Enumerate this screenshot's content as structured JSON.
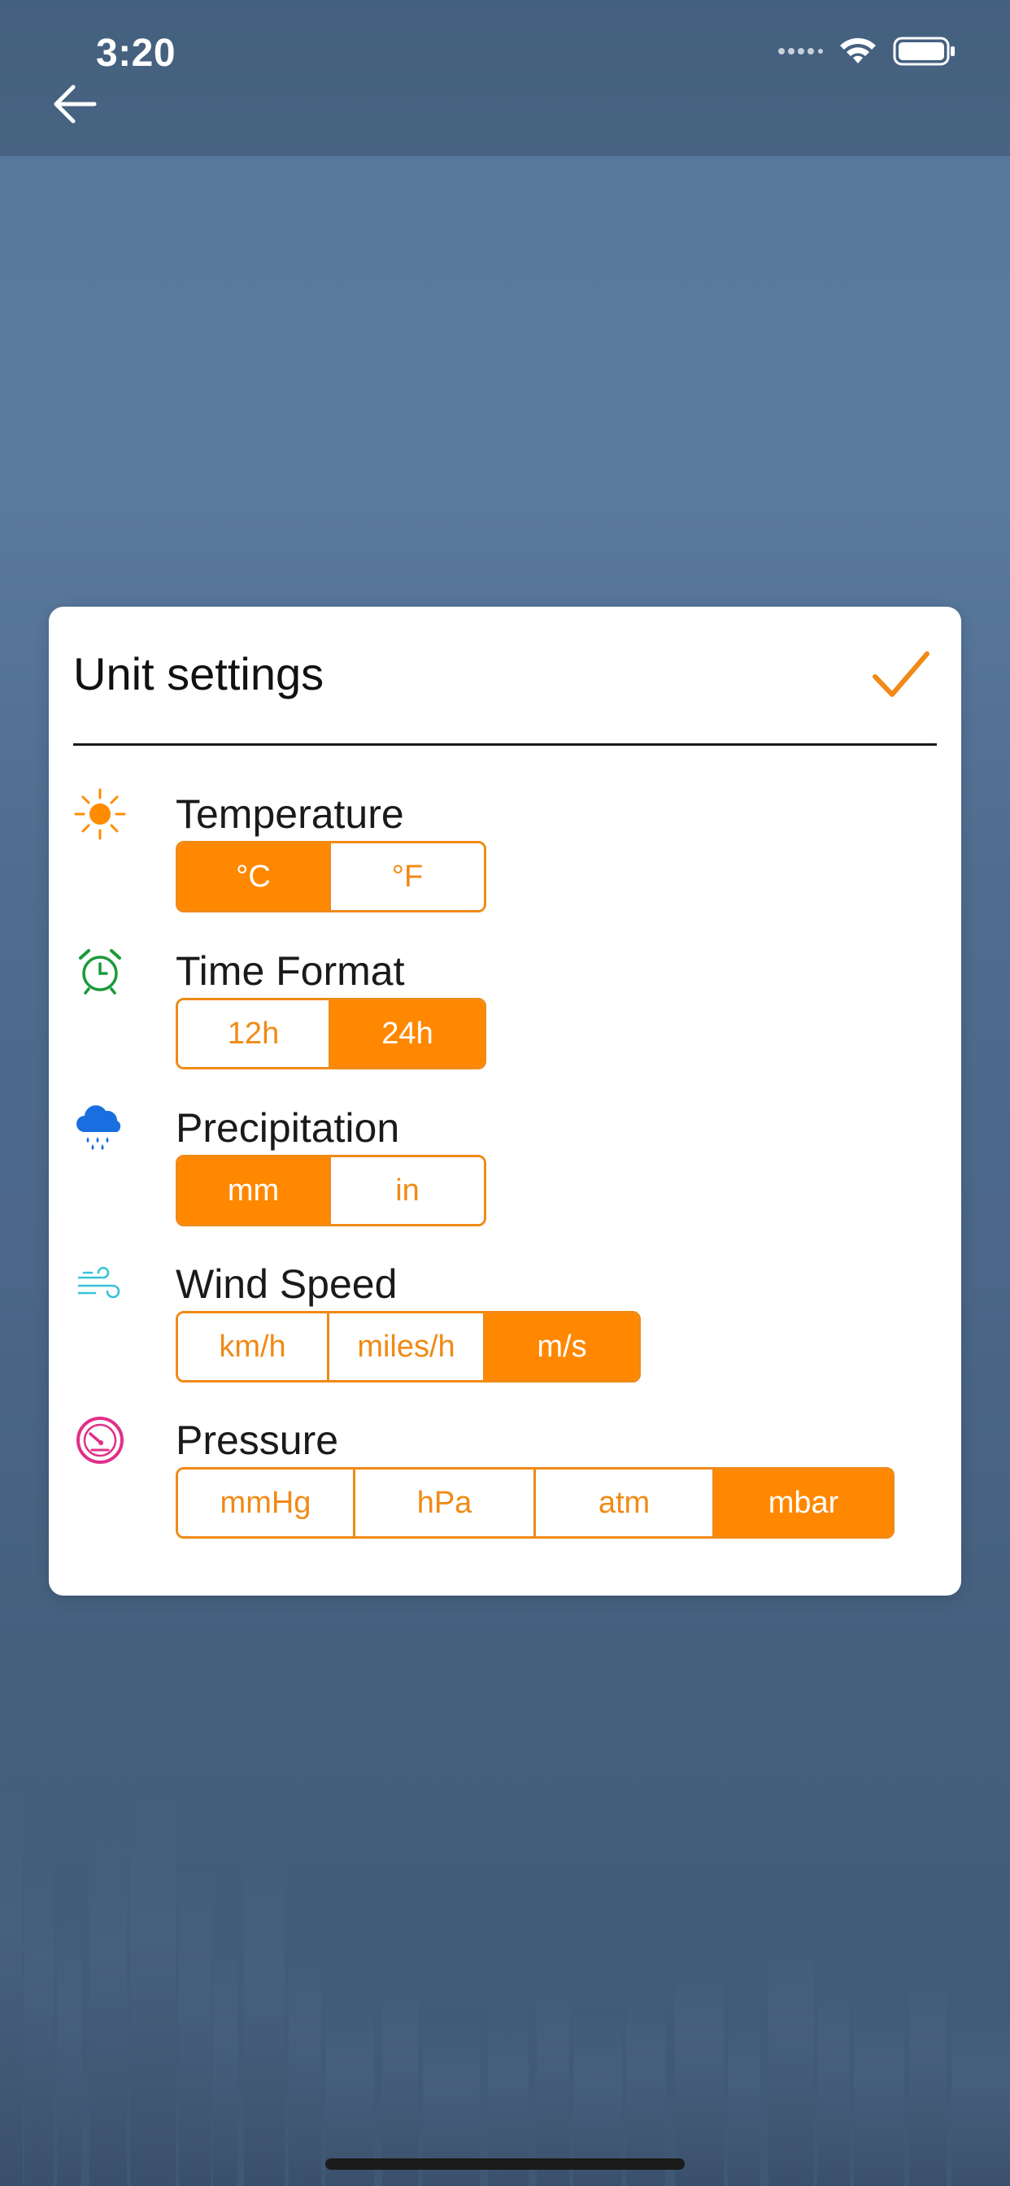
{
  "status_bar": {
    "time": "3:20",
    "icons": [
      "signal-dots-icon",
      "wifi-icon",
      "battery-icon"
    ]
  },
  "nav": {
    "back_icon": "arrow-left-icon"
  },
  "dialog": {
    "title": "Unit settings",
    "confirm_icon": "checkmark-icon",
    "accent_color": "#ff8800",
    "settings": [
      {
        "key": "temperature",
        "label": "Temperature",
        "icon": "sun-icon",
        "options": [
          "°C",
          "°F"
        ],
        "selected": "°C"
      },
      {
        "key": "time_format",
        "label": "Time Format",
        "icon": "alarm-clock-icon",
        "options": [
          "12h",
          "24h"
        ],
        "selected": "24h"
      },
      {
        "key": "precipitation",
        "label": "Precipitation",
        "icon": "rain-cloud-icon",
        "options": [
          "mm",
          "in"
        ],
        "selected": "mm"
      },
      {
        "key": "wind_speed",
        "label": "Wind Speed",
        "icon": "wind-icon",
        "options": [
          "km/h",
          "miles/h",
          "m/s"
        ],
        "selected": "m/s"
      },
      {
        "key": "pressure",
        "label": "Pressure",
        "icon": "gauge-icon",
        "options": [
          "mmHg",
          "hPa",
          "atm",
          "mbar"
        ],
        "selected": "mbar"
      }
    ]
  }
}
